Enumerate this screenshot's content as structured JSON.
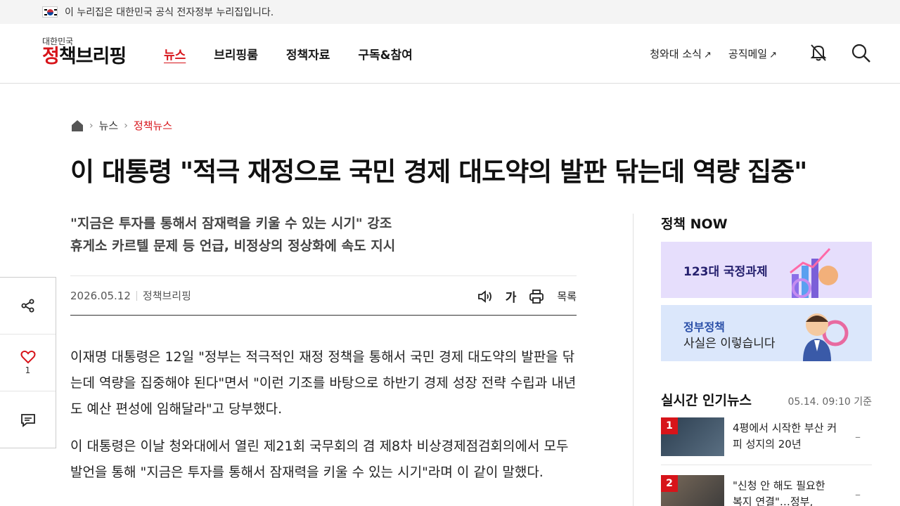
{
  "gov_bar": {
    "text": "이 누리집은 대한민국 공식 전자정부 누리집입니다."
  },
  "logo": {
    "small": "대한민국",
    "big_part1": "정",
    "big_part2": "책브리핑"
  },
  "nav": [
    {
      "label": "뉴스",
      "active": true
    },
    {
      "label": "브리핑룸",
      "active": false
    },
    {
      "label": "정책자료",
      "active": false
    },
    {
      "label": "구독&참여",
      "active": false
    }
  ],
  "ext_links": [
    {
      "label": "청와대 소식",
      "arrow": "↗"
    },
    {
      "label": "공직메일",
      "arrow": "↗"
    }
  ],
  "breadcrumb": {
    "level1": "뉴스",
    "level2": "정책뉴스",
    "sep": "›"
  },
  "article": {
    "headline": "이 대통령 \"적극 재정으로 국민 경제 대도약의 발판 닦는데 역량 집중\"",
    "subtitle1": "\"지금은 투자를 통해서 잠재력을 키울 수 있는 시기\" 강조",
    "subtitle2": "휴게소 카르텔 문제 등 언급, 비정상의 정상화에 속도 지시",
    "date": "2026.05.12",
    "source": "정책브리핑",
    "tool_font": "가",
    "tool_list": "목록",
    "para1": "이재명 대통령은 12일 \"정부는 적극적인 재정 정책을 통해서 국민 경제 대도약의 발판을 닦는데 역량을 집중해야 된다\"면서 \"이런 기조를 바탕으로 하반기 경제 성장 전략 수립과 내년도 예산 편성에 임해달라\"고 당부했다.",
    "para2": "이 대통령은 이날 청와대에서 열린 제21회 국무회의 겸 제8차 비상경제점검회의에서 모두발언을 통해 \"지금은 투자를 통해서 잠재력을 키울 수 있는 시기\"라며 이 같이 말했다."
  },
  "side_float": {
    "like_count": "1"
  },
  "aside": {
    "title": "정책 NOW",
    "banner1": "123대 국정과제",
    "banner2_line1": "정부정책",
    "banner2_line2": "사실은 이렇습니다"
  },
  "popular": {
    "title": "실시간 인기뉴스",
    "timestamp": "05.14. 09:10 기준",
    "items": [
      {
        "rank": "1",
        "title": "4평에서 시작한 부산 커피 성지의 20년",
        "dash": "–"
      },
      {
        "rank": "2",
        "title": "\"신청 안 해도 필요한 복지 연결\"…정부,",
        "dash": "–"
      }
    ]
  },
  "colors": {
    "accent": "#d7141a"
  }
}
